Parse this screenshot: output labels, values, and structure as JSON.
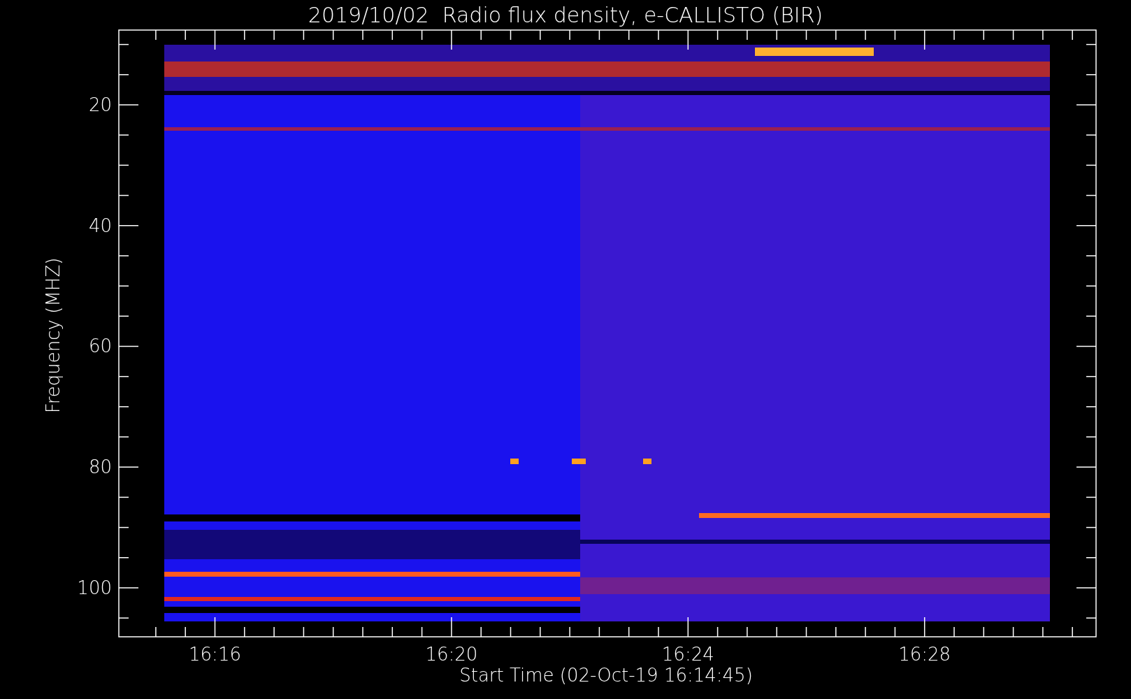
{
  "title": "2019/10/02  Radio flux density, e-CALLISTO (BIR)",
  "y_axis": {
    "label": "Frequency (MHZ)",
    "ticks": [
      "20",
      "40",
      "60",
      "80",
      "100"
    ]
  },
  "x_axis": {
    "label": "Start Time (02-Oct-19 16:14:45)",
    "ticks": [
      "16:16",
      "16:20",
      "16:24",
      "16:28"
    ]
  }
}
